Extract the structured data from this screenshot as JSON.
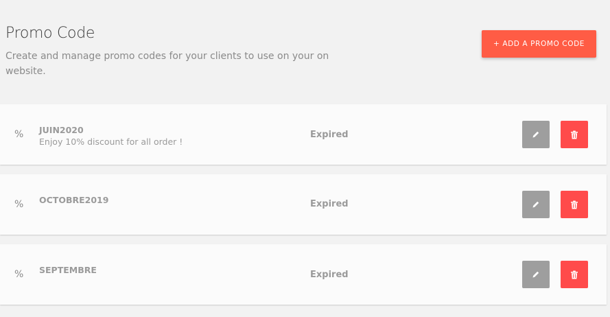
{
  "header": {
    "title": "Promo Code",
    "subtitle": "Create and manage promo codes for your clients to use on your on website."
  },
  "actions": {
    "add_label": "+ ADD A PROMO CODE"
  },
  "icons": {
    "row_icon": "percent-icon",
    "edit_icon": "pencil-icon",
    "delete_icon": "trash-icon"
  },
  "colors": {
    "accent": "#ff5c45",
    "delete": "#ff4b4b",
    "edit": "#9e9e9e",
    "background": "#f2f2f2",
    "card": "#fbfbfb"
  },
  "promos": [
    {
      "code": "JUIN2020",
      "description": "Enjoy 10% discount for all order !",
      "status": "Expired"
    },
    {
      "code": "OCTOBRE2019",
      "description": "",
      "status": "Expired"
    },
    {
      "code": "SEPTEMBRE",
      "description": "",
      "status": "Expired"
    }
  ]
}
